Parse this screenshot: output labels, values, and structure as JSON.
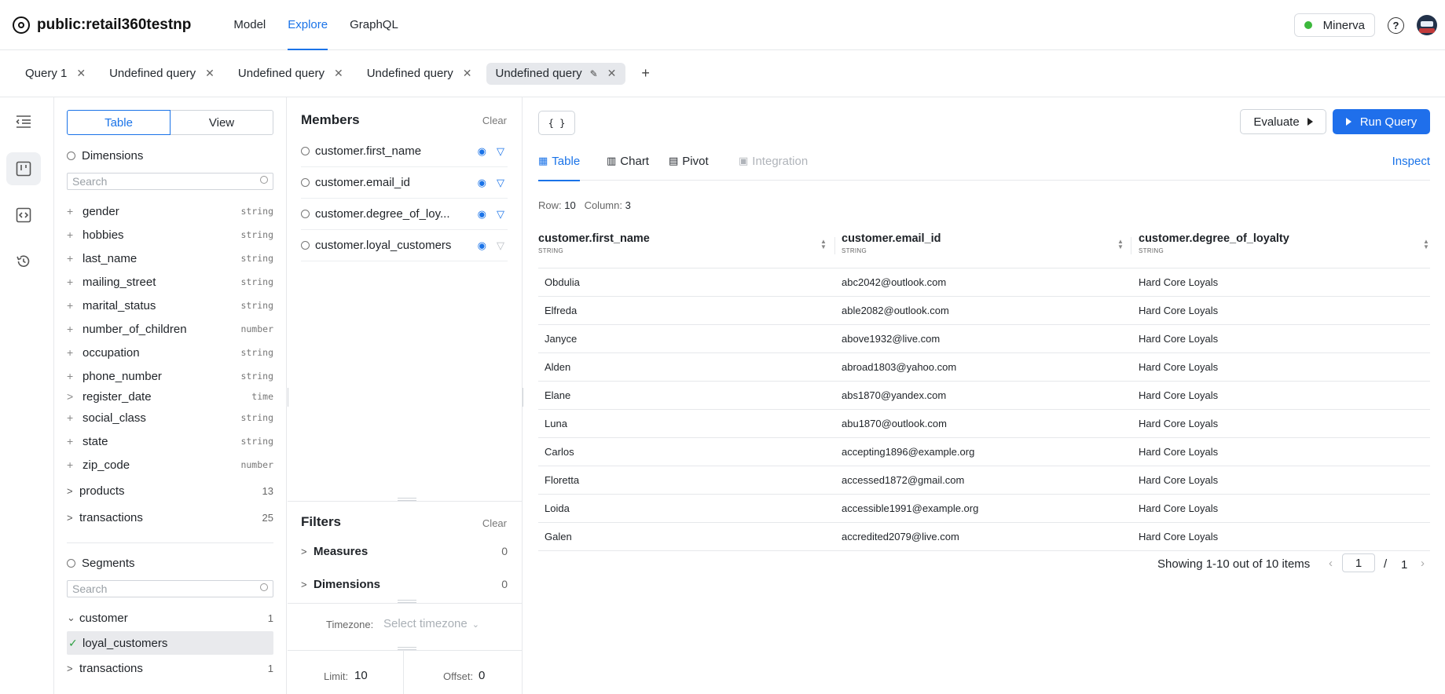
{
  "app": {
    "title": "public:retail360testnp"
  },
  "nav": [
    {
      "label": "Model"
    },
    {
      "label": "Explore"
    },
    {
      "label": "GraphQL"
    }
  ],
  "env": {
    "label": "Minerva",
    "status_color": "#3cb83c"
  },
  "help": {
    "glyph": "?"
  },
  "query_tabs": [
    {
      "label": "Query 1"
    },
    {
      "label": "Undefined query"
    },
    {
      "label": "Undefined query"
    },
    {
      "label": "Undefined query"
    },
    {
      "label": "Undefined query"
    }
  ],
  "schema": {
    "toggle": {
      "table": "Table",
      "view": "View"
    },
    "dimensions_title": "Dimensions",
    "search_placeholder": "Search",
    "dimensions": [
      {
        "pre": "+",
        "name": "gender",
        "type": "string"
      },
      {
        "pre": "+",
        "name": "hobbies",
        "type": "string"
      },
      {
        "pre": "+",
        "name": "last_name",
        "type": "string"
      },
      {
        "pre": "+",
        "name": "mailing_street",
        "type": "string"
      },
      {
        "pre": "+",
        "name": "marital_status",
        "type": "string"
      },
      {
        "pre": "+",
        "name": "number_of_children",
        "type": "number"
      },
      {
        "pre": "+",
        "name": "occupation",
        "type": "string"
      },
      {
        "pre": "+",
        "name": "phone_number",
        "type": "string"
      },
      {
        "pre": ">",
        "name": "register_date",
        "type": "time"
      },
      {
        "pre": "+",
        "name": "social_class",
        "type": "string"
      },
      {
        "pre": "+",
        "name": "state",
        "type": "string"
      },
      {
        "pre": "+",
        "name": "zip_code",
        "type": "number"
      }
    ],
    "groups": [
      {
        "name": "products",
        "count": "13"
      },
      {
        "name": "transactions",
        "count": "25"
      }
    ],
    "segments_title": "Segments",
    "segments": {
      "customer": {
        "name": "customer",
        "count": "1"
      },
      "selected": {
        "name": "loyal_customers"
      },
      "transactions": {
        "name": "transactions",
        "count": "1"
      }
    }
  },
  "members": {
    "title": "Members",
    "clear": "Clear",
    "items": [
      {
        "name": "customer.first_name"
      },
      {
        "name": "customer.email_id"
      },
      {
        "name": "customer.degree_of_loy..."
      },
      {
        "name": "customer.loyal_customers"
      }
    ]
  },
  "filters": {
    "title": "Filters",
    "clear": "Clear",
    "measures": {
      "label": "Measures",
      "count": "0"
    },
    "dimensions": {
      "label": "Dimensions",
      "count": "0"
    },
    "timezone_label": "Timezone:",
    "timezone_placeholder": "Select timezone",
    "limit_label": "Limit:",
    "limit_value": "10",
    "offset_label": "Offset:",
    "offset_value": "0"
  },
  "toolbar": {
    "json": "{ }",
    "evaluate": "Evaluate",
    "run": "Run Query"
  },
  "view_tabs": [
    {
      "label": "Table"
    },
    {
      "label": "Chart"
    },
    {
      "label": "Pivot"
    },
    {
      "label": "Integration"
    }
  ],
  "inspect": "Inspect",
  "result_info": {
    "row_label": "Row:",
    "rows": "10",
    "col_label": "Column:",
    "cols": "3"
  },
  "table": {
    "columns": [
      {
        "name": "customer.first_name",
        "type": "STRING"
      },
      {
        "name": "customer.email_id",
        "type": "STRING"
      },
      {
        "name": "customer.degree_of_loyalty",
        "type": "STRING"
      }
    ],
    "rows": [
      [
        "Obdulia",
        "abc2042@outlook.com",
        "Hard Core Loyals"
      ],
      [
        "Elfreda",
        "able2082@outlook.com",
        "Hard Core Loyals"
      ],
      [
        "Janyce",
        "above1932@live.com",
        "Hard Core Loyals"
      ],
      [
        "Alden",
        "abroad1803@yahoo.com",
        "Hard Core Loyals"
      ],
      [
        "Elane",
        "abs1870@yandex.com",
        "Hard Core Loyals"
      ],
      [
        "Luna",
        "abu1870@outlook.com",
        "Hard Core Loyals"
      ],
      [
        "Carlos",
        "accepting1896@example.org",
        "Hard Core Loyals"
      ],
      [
        "Floretta",
        "accessed1872@gmail.com",
        "Hard Core Loyals"
      ],
      [
        "Loida",
        "accessible1991@example.org",
        "Hard Core Loyals"
      ],
      [
        "Galen",
        "accredited2079@live.com",
        "Hard Core Loyals"
      ]
    ]
  },
  "pagination": {
    "text": "Showing 1-10 out of 10 items",
    "page": "1",
    "separator": "/",
    "total": "1"
  },
  "colors": {
    "accent": "#1a73e8",
    "run_button": "#1f6feb"
  }
}
